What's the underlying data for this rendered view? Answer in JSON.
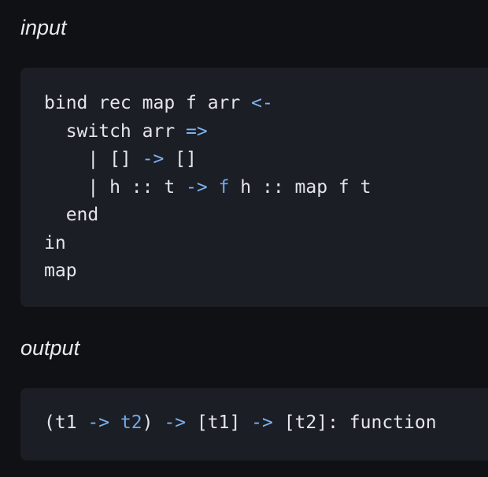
{
  "input": {
    "label": "input",
    "lines": [
      [
        {
          "t": "bind rec map f arr ",
          "k": "plain"
        },
        {
          "t": "<-",
          "k": "op"
        }
      ],
      [
        {
          "t": "  switch arr ",
          "k": "plain"
        },
        {
          "t": "=>",
          "k": "op"
        }
      ],
      [
        {
          "t": "    | [] ",
          "k": "plain"
        },
        {
          "t": "->",
          "k": "op"
        },
        {
          "t": " []",
          "k": "plain"
        }
      ],
      [
        {
          "t": "    | h :: t ",
          "k": "plain"
        },
        {
          "t": "->",
          "k": "op"
        },
        {
          "t": " ",
          "k": "plain"
        },
        {
          "t": "f",
          "k": "fn"
        },
        {
          "t": " h :: map f t",
          "k": "plain"
        }
      ],
      [
        {
          "t": "  end",
          "k": "plain"
        }
      ],
      [
        {
          "t": "in",
          "k": "plain"
        }
      ],
      [
        {
          "t": "map",
          "k": "plain"
        }
      ]
    ]
  },
  "output": {
    "label": "output",
    "lines": [
      [
        {
          "t": "(t1 ",
          "k": "plain"
        },
        {
          "t": "->",
          "k": "op"
        },
        {
          "t": " ",
          "k": "plain"
        },
        {
          "t": "t2",
          "k": "fn"
        },
        {
          "t": ") ",
          "k": "plain"
        },
        {
          "t": "->",
          "k": "op"
        },
        {
          "t": " [t1] ",
          "k": "plain"
        },
        {
          "t": "->",
          "k": "op"
        },
        {
          "t": " [t2]: function",
          "k": "plain"
        }
      ]
    ]
  },
  "colors": {
    "background": "#0f1115",
    "code_background": "#1b1e25",
    "text": "#e4e6eb",
    "operator": "#7db3f0",
    "identifier_highlight": "#6fa8ec"
  }
}
